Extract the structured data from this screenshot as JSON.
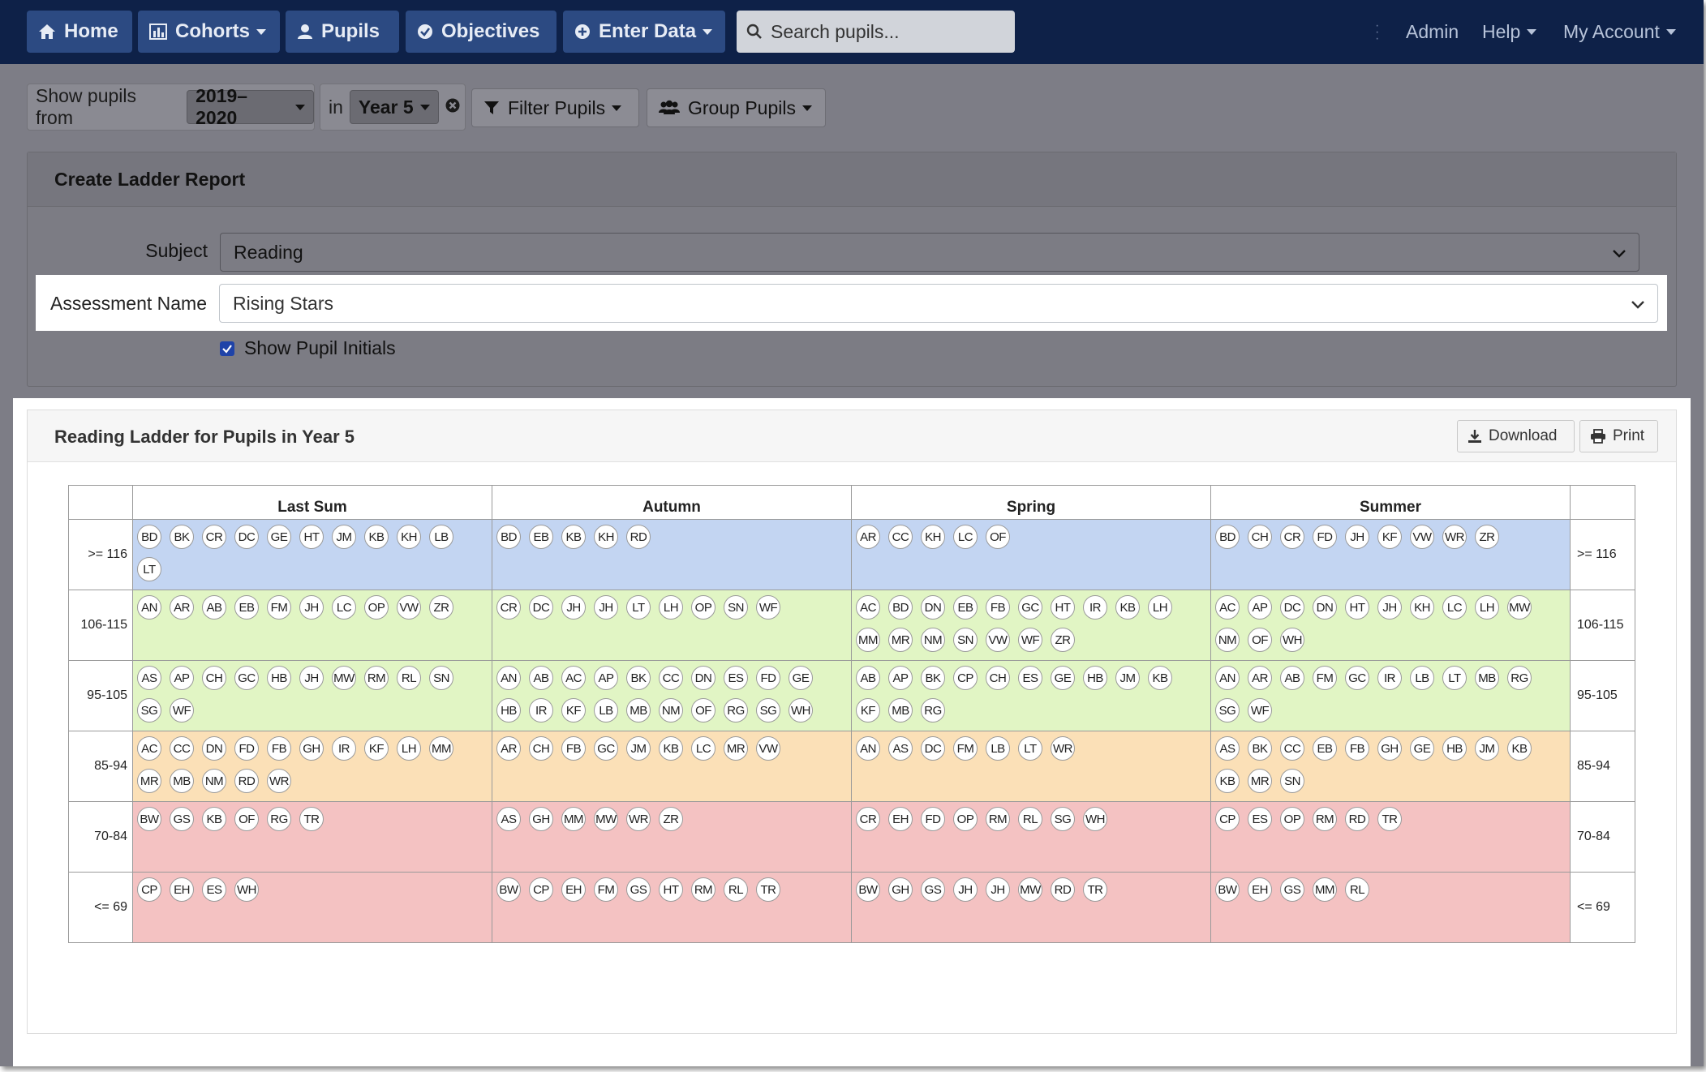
{
  "nav": {
    "home": "Home",
    "cohorts": "Cohorts",
    "pupils": "Pupils",
    "objectives": "Objectives",
    "enter_data": "Enter Data",
    "search_placeholder": "Search pupils...",
    "admin": "Admin",
    "help": "Help",
    "my_account": "My Account"
  },
  "filters": {
    "show_pupils_from_label": "Show pupils from",
    "year_range": "2019–2020",
    "in_label": "in",
    "year_group": "Year 5",
    "filter_pupils": "Filter Pupils",
    "group_pupils": "Group Pupils"
  },
  "create": {
    "title": "Create Ladder Report",
    "subject_label": "Subject",
    "subject_value": "Reading",
    "assessment_label": "Assessment Name",
    "assessment_value": "Rising Stars",
    "show_initials_label": "Show Pupil Initials",
    "show_initials_checked": true
  },
  "report": {
    "title": "Reading Ladder for Pupils in Year 5",
    "download": "Download",
    "print": "Print",
    "columns": [
      "Last Sum",
      "Autumn",
      "Spring",
      "Summer"
    ],
    "bands": [
      {
        "label": ">= 116",
        "color": "#c3d5f2",
        "cells": [
          [
            "BD",
            "BK",
            "CR",
            "DC",
            "GE",
            "HT",
            "JM",
            "KB",
            "KH",
            "LB",
            "LT"
          ],
          [
            "BD",
            "EB",
            "KB",
            "KH",
            "RD"
          ],
          [
            "AR",
            "CC",
            "KH",
            "LC",
            "OF"
          ],
          [
            "BD",
            "CH",
            "CR",
            "FD",
            "JH",
            "KF",
            "VW",
            "WR",
            "ZR"
          ]
        ]
      },
      {
        "label": "106-115",
        "color": "#e1f5c4",
        "cells": [
          [
            "AN",
            "AR",
            "AB",
            "EB",
            "FM",
            "JH",
            "LC",
            "OP",
            "VW",
            "ZR"
          ],
          [
            "CR",
            "DC",
            "JH",
            "JH",
            "LT",
            "LH",
            "OP",
            "SN",
            "WF"
          ],
          [
            "AC",
            "BD",
            "DN",
            "EB",
            "FB",
            "GC",
            "HT",
            "IR",
            "KB",
            "LH",
            "MM",
            "MR",
            "NM",
            "SN",
            "VW",
            "WF",
            "ZR"
          ],
          [
            "AC",
            "AP",
            "DC",
            "DN",
            "HT",
            "JH",
            "KH",
            "LC",
            "LH",
            "MW",
            "NM",
            "OF",
            "WH"
          ]
        ]
      },
      {
        "label": "95-105",
        "color": "#e1f5c4",
        "cells": [
          [
            "AS",
            "AP",
            "CH",
            "GC",
            "HB",
            "JH",
            "MW",
            "RM",
            "RL",
            "SN",
            "SG",
            "WF"
          ],
          [
            "AN",
            "AB",
            "AC",
            "AP",
            "BK",
            "CC",
            "DN",
            "ES",
            "FD",
            "GE",
            "HB",
            "IR",
            "KF",
            "LB",
            "MB",
            "NM",
            "OF",
            "RG",
            "SG",
            "WH"
          ],
          [
            "AB",
            "AP",
            "BK",
            "CP",
            "CH",
            "ES",
            "GE",
            "HB",
            "JM",
            "KB",
            "KF",
            "MB",
            "RG"
          ],
          [
            "AN",
            "AR",
            "AB",
            "FM",
            "GC",
            "IR",
            "LB",
            "LT",
            "MB",
            "RG",
            "SG",
            "WF"
          ]
        ]
      },
      {
        "label": "85-94",
        "color": "#fbe0b7",
        "cells": [
          [
            "AC",
            "CC",
            "DN",
            "FD",
            "FB",
            "GH",
            "IR",
            "KF",
            "LH",
            "MM",
            "MR",
            "MB",
            "NM",
            "RD",
            "WR"
          ],
          [
            "AR",
            "CH",
            "FB",
            "GC",
            "JM",
            "KB",
            "LC",
            "MR",
            "VW"
          ],
          [
            "AN",
            "AS",
            "DC",
            "FM",
            "LB",
            "LT",
            "WR"
          ],
          [
            "AS",
            "BK",
            "CC",
            "EB",
            "FB",
            "GH",
            "GE",
            "HB",
            "JM",
            "KB",
            "KB",
            "MR",
            "SN"
          ]
        ]
      },
      {
        "label": "70-84",
        "color": "#f4c2c2",
        "cells": [
          [
            "BW",
            "GS",
            "KB",
            "OF",
            "RG",
            "TR"
          ],
          [
            "AS",
            "GH",
            "MM",
            "MW",
            "WR",
            "ZR"
          ],
          [
            "CR",
            "EH",
            "FD",
            "OP",
            "RM",
            "RL",
            "SG",
            "WH"
          ],
          [
            "CP",
            "ES",
            "OP",
            "RM",
            "RD",
            "TR"
          ]
        ]
      },
      {
        "label": "<= 69",
        "color": "#f4c2c2",
        "cells": [
          [
            "CP",
            "EH",
            "ES",
            "WH"
          ],
          [
            "BW",
            "CP",
            "EH",
            "FM",
            "GS",
            "HT",
            "RM",
            "RL",
            "TR"
          ],
          [
            "BW",
            "GH",
            "GS",
            "JH",
            "JH",
            "MW",
            "RD",
            "TR"
          ],
          [
            "BW",
            "EH",
            "GS",
            "MM",
            "RL"
          ]
        ]
      }
    ]
  },
  "colors": {
    "navbar": "#0e2148",
    "nav_button": "#2c4a82",
    "overlay": "#7d7d86",
    "checkbox": "#1f43a8"
  }
}
